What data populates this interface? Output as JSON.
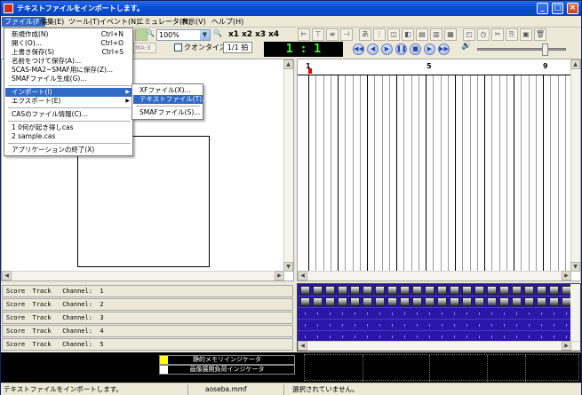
{
  "window": {
    "title": "テキストファイルをインポートします。",
    "buttons": {
      "minimize": "_",
      "maximize": "□",
      "close": "×"
    }
  },
  "menubar": [
    "ファイル(F)",
    "編集(E)",
    "ツール(T)",
    "イベント(N)",
    "エミュレータ(M)",
    "表示(V)",
    "ヘルプ(H)"
  ],
  "file_menu": {
    "new": {
      "label": "新規作成(N)",
      "shortcut": "Ctrl+N"
    },
    "open": {
      "label": "開く(O)...",
      "shortcut": "Ctrl+O"
    },
    "save": {
      "label": "上書き保存(S)",
      "shortcut": "Ctrl+S"
    },
    "save_as": {
      "label": "名前をつけて保存(A)..."
    },
    "save_smaf": {
      "label": "SCAS-MA2~SMAF用に保存(Z)..."
    },
    "generate_smaf": {
      "label": "SMAFファイル生成(G)..."
    },
    "import": {
      "label": "インポート(I)"
    },
    "export": {
      "label": "エクスポート(E)"
    },
    "cas_info": {
      "label": "CASのファイル情報(C)..."
    },
    "recent_1": {
      "label": "1 0何が起き得しcas"
    },
    "recent_2": {
      "label": "2 sample.cas"
    },
    "exit": {
      "label": "アプリケーションの終了(X)"
    }
  },
  "import_submenu": {
    "xf": "XFファイル(X)...",
    "text": "テキストファイル(T)...",
    "smaf": "SMAFファイル(S)..."
  },
  "toolbar": {
    "zoom": "100%",
    "x1": "x1",
    "x2": "x2",
    "x3": "x3",
    "x4": "x4",
    "device": "MA-3",
    "quantize_label": "クオンタイズ",
    "beat_label": "1/1 拍",
    "position": "1 : 1",
    "transport_icons": [
      "rewind-icon",
      "prev-icon",
      "play-icon",
      "pause-icon",
      "stop-icon",
      "next-icon",
      "forward-icon"
    ]
  },
  "ruler": {
    "marks": [
      "1",
      "5",
      "9"
    ]
  },
  "tracks": [
    "Score  Track   Channel:  1",
    "Score  Track   Channel:  2",
    "Score  Track   Channel:  3",
    "Score  Track   Channel:  4",
    "Score  Track   Channel:  5"
  ],
  "indicators": {
    "memory": "静的メモリインジケータ",
    "image": "画像展開負荷インジケータ"
  },
  "colors": {
    "accent": "#316ac5",
    "timeline_bg": "#2a16a8",
    "lcd_text": "#38ff38"
  },
  "status": {
    "message": "テキストファイルをインポートします。",
    "file": "aoseba.mmf",
    "selection": "選択されていません。"
  }
}
